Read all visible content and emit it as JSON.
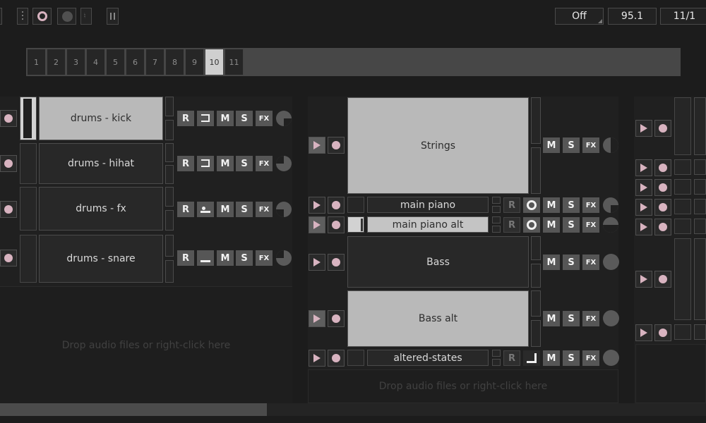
{
  "status": {
    "mode": "Off",
    "tempo": "95.1",
    "time_sig": "11/1"
  },
  "scenes": [
    "1",
    "2",
    "3",
    "4",
    "5",
    "6",
    "7",
    "8",
    "9",
    "10",
    "11"
  ],
  "active_scene": "10",
  "buttons": {
    "record": "R",
    "mute": "M",
    "solo": "S",
    "fx": "FX"
  },
  "column1": {
    "tracks": [
      "drums - kick",
      "drums - hihat",
      "drums - fx",
      "drums - snare"
    ],
    "drop_text": "Drop audio files or right-click here"
  },
  "column2": {
    "clips": [
      "Strings",
      "main piano",
      "main piano alt",
      "Bass",
      "Bass alt",
      "altered-states"
    ],
    "drop_text": "Drop audio files or right-click here"
  },
  "colors": {
    "accent_pink": "#d8b3c0",
    "clip_active": "#b9b9b9",
    "background": "#1c1c1c"
  }
}
